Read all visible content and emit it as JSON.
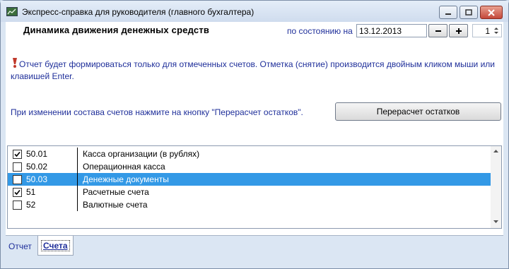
{
  "window": {
    "title": "Экспресс-справка для руководителя (главного бухгалтера)",
    "icon": "app-icon"
  },
  "header": {
    "report_title": "Динамика движения денежных средств",
    "asof_label": "по состоянию на",
    "date_value": "13.12.2013",
    "minus_icon": "minus-icon",
    "plus_icon": "plus-icon",
    "spin_value": "1"
  },
  "notice": {
    "icon": "warning-icon",
    "text": "Отчет будет формироваться только для отмеченных счетов. Отметка (снятие)  производится двойным кликом мыши или клавишей Enter."
  },
  "recalc": {
    "hint": "При изменении состава счетов нажмите на кнопку \"Перерасчет остатков\".",
    "button_label": "Перерасчет остатков"
  },
  "accounts": [
    {
      "code": "50.01",
      "name": "Касса организации (в рублях)",
      "checked": true,
      "selected": false
    },
    {
      "code": "50.02",
      "name": "Операционная касса",
      "checked": false,
      "selected": false
    },
    {
      "code": "50.03",
      "name": "Денежные документы",
      "checked": false,
      "selected": true
    },
    {
      "code": "51",
      "name": "Расчетные счета",
      "checked": true,
      "selected": false
    },
    {
      "code": "52",
      "name": "Валютные счета",
      "checked": false,
      "selected": false
    }
  ],
  "tabs": [
    {
      "label": "Отчет",
      "active": false
    },
    {
      "label": "Счета",
      "active": true
    }
  ],
  "colors": {
    "label_blue": "#1f2f9a",
    "selection": "#3399e6"
  }
}
